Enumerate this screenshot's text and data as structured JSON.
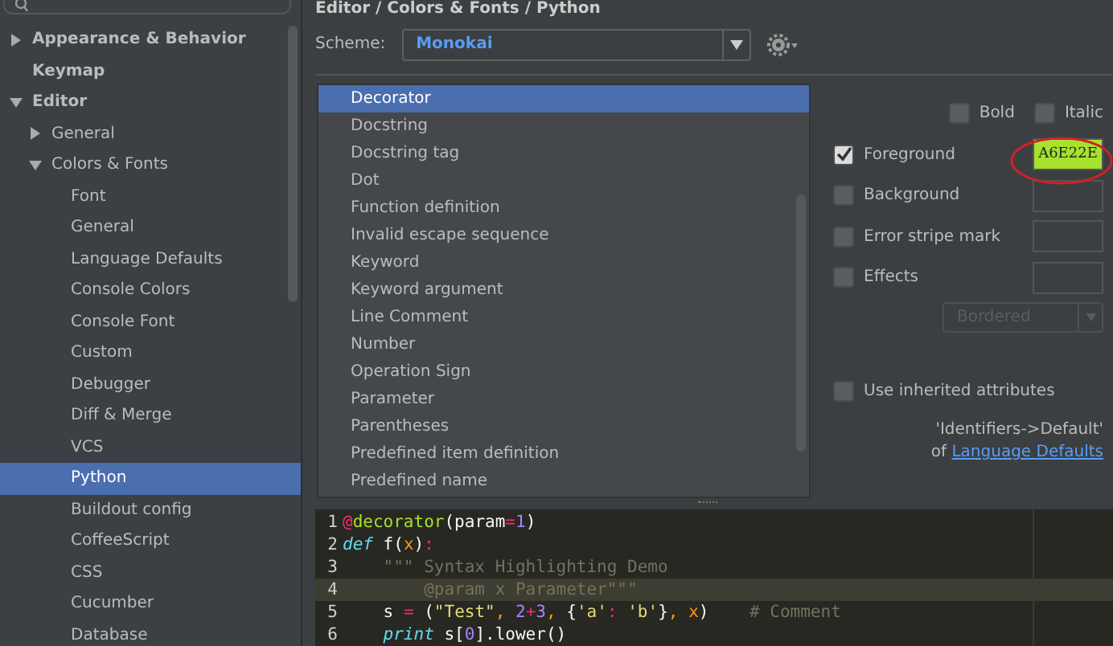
{
  "breadcrumb": "Editor / Colors & Fonts / Python",
  "sidebar": {
    "items": [
      {
        "label": "Appearance & Behavior",
        "expanded": false,
        "selected": false
      },
      {
        "label": "Keymap",
        "selected": false
      },
      {
        "label": "Editor",
        "expanded": true,
        "selected": false,
        "children": [
          {
            "label": "General",
            "expanded": false,
            "selected": false
          },
          {
            "label": "Colors & Fonts",
            "expanded": true,
            "selected": false,
            "children": [
              {
                "label": "Font",
                "selected": false
              },
              {
                "label": "General",
                "selected": false
              },
              {
                "label": "Language Defaults",
                "selected": false
              },
              {
                "label": "Console Colors",
                "selected": false
              },
              {
                "label": "Console Font",
                "selected": false
              },
              {
                "label": "Custom",
                "selected": false
              },
              {
                "label": "Debugger",
                "selected": false
              },
              {
                "label": "Diff & Merge",
                "selected": false
              },
              {
                "label": "VCS",
                "selected": false
              },
              {
                "label": "Python",
                "selected": true
              },
              {
                "label": "Buildout config",
                "selected": false
              },
              {
                "label": "CoffeeScript",
                "selected": false
              },
              {
                "label": "CSS",
                "selected": false
              },
              {
                "label": "Cucumber",
                "selected": false
              },
              {
                "label": "Database",
                "selected": false
              }
            ]
          }
        ]
      }
    ]
  },
  "scheme": {
    "label": "Scheme:",
    "value": "Monokai"
  },
  "attributes_list": {
    "items": [
      {
        "label": "Decorator",
        "selected": true
      },
      {
        "label": "Docstring",
        "selected": false
      },
      {
        "label": "Docstring tag",
        "selected": false
      },
      {
        "label": "Dot",
        "selected": false
      },
      {
        "label": "Function definition",
        "selected": false
      },
      {
        "label": "Invalid escape sequence",
        "selected": false
      },
      {
        "label": "Keyword",
        "selected": false
      },
      {
        "label": "Keyword argument",
        "selected": false
      },
      {
        "label": "Line Comment",
        "selected": false
      },
      {
        "label": "Number",
        "selected": false
      },
      {
        "label": "Operation Sign",
        "selected": false
      },
      {
        "label": "Parameter",
        "selected": false
      },
      {
        "label": "Parentheses",
        "selected": false
      },
      {
        "label": "Predefined item definition",
        "selected": false
      },
      {
        "label": "Predefined name",
        "selected": false
      }
    ]
  },
  "options": {
    "bold": {
      "label": "Bold",
      "checked": false
    },
    "italic": {
      "label": "Italic",
      "checked": false
    },
    "attributes": [
      {
        "label": "Foreground",
        "checked": true,
        "value": "A6E22E"
      },
      {
        "label": "Background",
        "checked": false
      },
      {
        "label": "Error stripe mark",
        "checked": false
      },
      {
        "label": "Effects",
        "checked": false
      }
    ],
    "effect_type": {
      "value": "Bordered",
      "disabled": true
    },
    "inherit": {
      "label": "Use inherited attributes",
      "checked": false
    },
    "inherit_source": "'Identifiers->Default'",
    "inherit_of": "of",
    "inherit_link": "Language Defaults"
  },
  "code": {
    "lines": [
      {
        "number": "1",
        "current": false,
        "tokens": [
          {
            "text": "@",
            "kind": "op"
          },
          {
            "text": "decorator",
            "kind": "decorator"
          },
          {
            "text": "(param",
            "kind": "plain"
          },
          {
            "text": "=",
            "kind": "op"
          },
          {
            "text": "1",
            "kind": "number"
          },
          {
            "text": ")",
            "kind": "plain"
          }
        ]
      },
      {
        "number": "2",
        "current": false,
        "tokens": [
          {
            "text": "def",
            "kind": "keyword"
          },
          {
            "text": " f(",
            "kind": "plain"
          },
          {
            "text": "x",
            "kind": "param"
          },
          {
            "text": ")",
            "kind": "plain"
          },
          {
            "text": ":",
            "kind": "op"
          }
        ]
      },
      {
        "number": "3",
        "current": false,
        "tokens": [
          {
            "text": "    \"\"\" Syntax Highlighting Demo",
            "kind": "docstring"
          }
        ]
      },
      {
        "number": "4",
        "current": true,
        "tokens": [
          {
            "text": "        @param x Parameter\"\"\"",
            "kind": "docstring"
          }
        ]
      },
      {
        "number": "5",
        "current": false,
        "tokens": [
          {
            "text": "    s ",
            "kind": "plain"
          },
          {
            "text": "=",
            "kind": "op"
          },
          {
            "text": " (",
            "kind": "plain"
          },
          {
            "text": "\"Test\"",
            "kind": "string"
          },
          {
            "text": ", ",
            "kind": "comma"
          },
          {
            "text": "2",
            "kind": "number"
          },
          {
            "text": "+",
            "kind": "op"
          },
          {
            "text": "3",
            "kind": "number"
          },
          {
            "text": ", ",
            "kind": "comma"
          },
          {
            "text": "{",
            "kind": "plain"
          },
          {
            "text": "'a'",
            "kind": "string"
          },
          {
            "text": ": ",
            "kind": "op"
          },
          {
            "text": "'b'",
            "kind": "string"
          },
          {
            "text": "}",
            "kind": "plain"
          },
          {
            "text": ", ",
            "kind": "comma"
          },
          {
            "text": "x",
            "kind": "param"
          },
          {
            "text": ")    ",
            "kind": "plain"
          },
          {
            "text": "# Comment",
            "kind": "comment"
          }
        ]
      },
      {
        "number": "6",
        "current": false,
        "tokens": [
          {
            "text": "    print",
            "kind": "keyword"
          },
          {
            "text": " s[",
            "kind": "plain"
          },
          {
            "text": "0",
            "kind": "number"
          },
          {
            "text": "].lower()",
            "kind": "plain"
          }
        ]
      }
    ]
  }
}
